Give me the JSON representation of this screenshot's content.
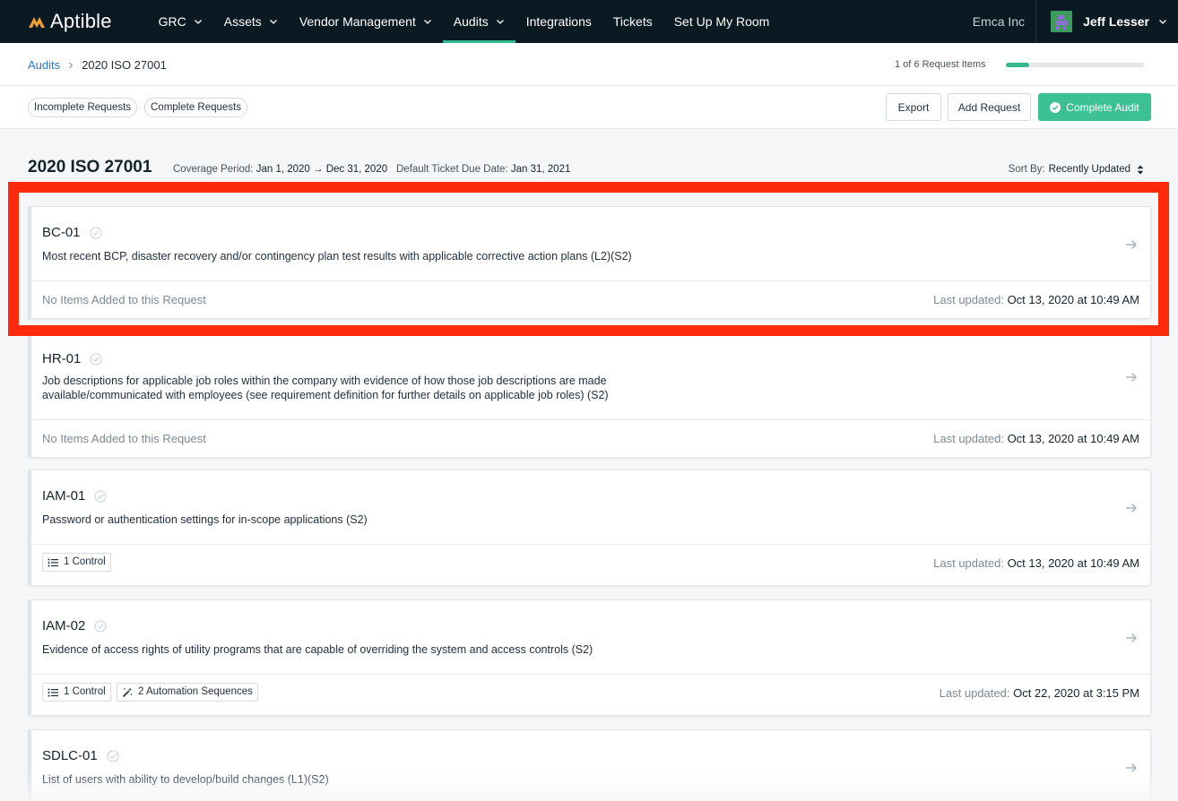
{
  "app": {
    "logo_text": "Aptible"
  },
  "nav": {
    "items": [
      {
        "label": "GRC",
        "has_menu": true
      },
      {
        "label": "Assets",
        "has_menu": true
      },
      {
        "label": "Vendor Management",
        "has_menu": true
      },
      {
        "label": "Audits",
        "has_menu": true,
        "active": true
      },
      {
        "label": "Integrations",
        "has_menu": false
      },
      {
        "label": "Tickets",
        "has_menu": false
      },
      {
        "label": "Set Up My Room",
        "has_menu": false
      }
    ],
    "org": "Emca Inc",
    "user": "Jeff Lesser"
  },
  "breadcrumb": {
    "parent": "Audits",
    "current": "2020 ISO 27001"
  },
  "progress": {
    "label": "1 of 6 Request Items",
    "completed": 1,
    "total": 6
  },
  "filters": {
    "incomplete": "Incomplete Requests",
    "complete": "Complete Requests"
  },
  "actions": {
    "export": "Export",
    "add_request": "Add Request",
    "complete_audit": "Complete Audit"
  },
  "heading": {
    "title": "2020 ISO 27001",
    "coverage_label": "Coverage Period:",
    "coverage_value": "Jan 1, 2020 → Dec 31, 2020",
    "due_label": "Default Ticket Due Date:",
    "due_value": "Jan 31, 2021",
    "sort_label": "Sort By:",
    "sort_value": "Recently Updated"
  },
  "requests": [
    {
      "id": "BC-01",
      "description": "Most recent BCP, disaster recovery and/or contingency plan test results with applicable corrective action plans (L2)(S2)",
      "empty_label": "No Items Added to this Request",
      "updated_label": "Last updated:",
      "updated_value": "Oct 13, 2020 at 10:49 AM"
    },
    {
      "id": "HR-01",
      "description": "Job descriptions for applicable job roles within the company with evidence of how those job descriptions are made available/communicated with employees (see requirement definition for further details on applicable job roles) (S2)",
      "empty_label": "No Items Added to this Request",
      "updated_label": "Last updated:",
      "updated_value": "Oct 13, 2020 at 10:49 AM"
    },
    {
      "id": "IAM-01",
      "description": "Password or authentication settings for in-scope applications (S2)",
      "tags": [
        "1 Control"
      ],
      "updated_label": "Last updated:",
      "updated_value": "Oct 13, 2020 at 10:49 AM"
    },
    {
      "id": "IAM-02",
      "description": "Evidence of access rights of utility programs that are capable of overriding the system and access controls (S2)",
      "tags": [
        "1 Control",
        "2 Automation Sequences"
      ],
      "updated_label": "Last updated:",
      "updated_value": "Oct 22, 2020 at 3:15 PM"
    },
    {
      "id": "SDLC-01",
      "description": "List of users with ability to develop/build changes (L1)(S2)"
    }
  ],
  "colors": {
    "nav_bg": "#0b1a22",
    "accent": "#34b98f",
    "link": "#2a79c4",
    "highlight": "#ff2a0c"
  }
}
